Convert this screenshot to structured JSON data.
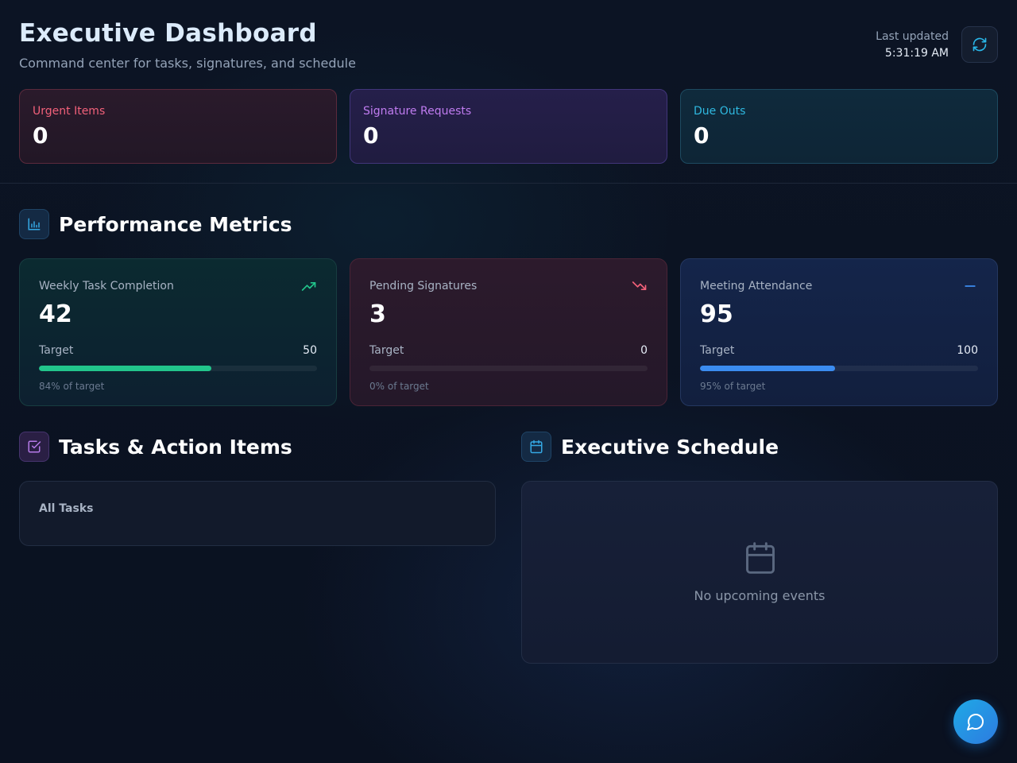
{
  "header": {
    "title": "Executive Dashboard",
    "subtitle": "Command center for tasks, signatures, and schedule",
    "last_updated_label": "Last updated",
    "last_updated_time": "5:31:19 AM",
    "refresh_icon": "refresh-icon"
  },
  "status_cards": [
    {
      "label": "Urgent Items",
      "value": "0",
      "color": "#f2617a"
    },
    {
      "label": "Signature Requests",
      "value": "0",
      "color": "#c07cf0"
    },
    {
      "label": "Due Outs",
      "value": "0",
      "color": "#2fb8e0"
    }
  ],
  "performance": {
    "title": "Performance Metrics",
    "icon": "bar-chart-icon",
    "metrics": [
      {
        "label": "Weekly Task Completion",
        "value": "42",
        "target_label": "Target",
        "target": "50",
        "percent_text": "84% of target",
        "progress": 0.62,
        "trend": "trending-up-icon",
        "color": "#22c58b"
      },
      {
        "label": "Pending Signatures",
        "value": "3",
        "target_label": "Target",
        "target": "0",
        "percent_text": "0% of target",
        "progress": 0,
        "trend": "trending-down-icon",
        "color": "#f2617a"
      },
      {
        "label": "Meeting Attendance",
        "value": "95",
        "target_label": "Target",
        "target": "100",
        "percent_text": "95% of target",
        "progress": 0.486,
        "trend": "minus-icon",
        "color": "#3b8cf0"
      }
    ]
  },
  "tasks": {
    "title": "Tasks & Action Items",
    "icon": "checkbox-icon",
    "heading": "All Tasks"
  },
  "schedule": {
    "title": "Executive Schedule",
    "icon": "calendar-icon",
    "empty_text": "No upcoming events"
  },
  "chat": {
    "icon": "chat-bubble-icon"
  }
}
